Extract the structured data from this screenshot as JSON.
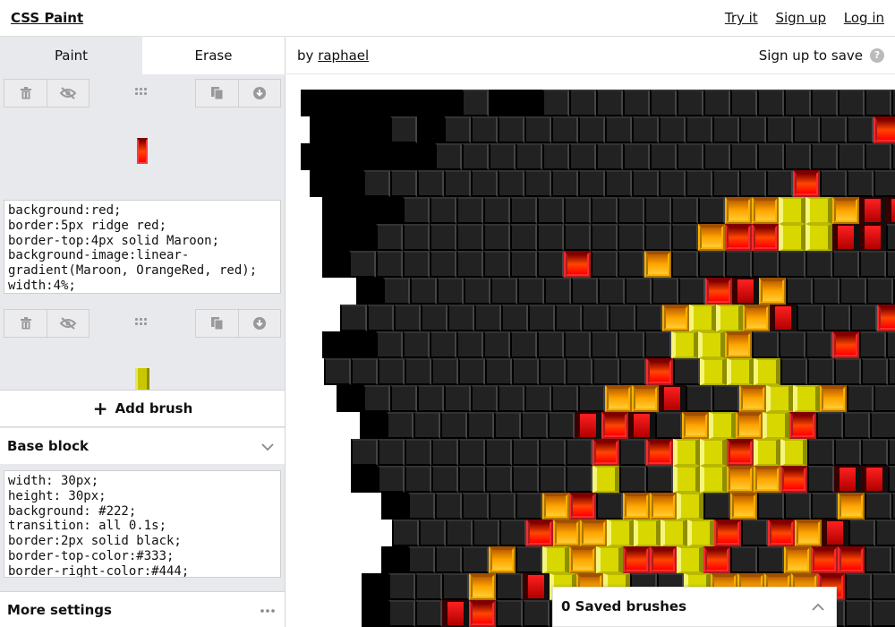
{
  "header": {
    "brand": "CSS Paint",
    "links": [
      "Try it",
      "Sign up",
      "Log in"
    ]
  },
  "tabs": {
    "paint": "Paint",
    "erase": "Erase"
  },
  "brushes": [
    {
      "css": "background:red;\nborder:5px ridge red;\nborder-top:4px solid Maroon;\nbackground-image:linear-gradient(Maroon, OrangeRed, red);\nwidth:4%;"
    },
    {
      "css": ""
    }
  ],
  "tools": {
    "left": [
      "trash-icon",
      "eye-off-icon"
    ],
    "middle": "drag-handle-icon",
    "right": [
      "copy-icon",
      "download-icon"
    ]
  },
  "add_brush": {
    "plus": "+",
    "label": "Add brush"
  },
  "base_block": {
    "title": "Base block",
    "css": "width: 30px;\nheight: 30px;\nbackground: #222;\ntransition: all 0.1s;\nborder:2px solid black;\nborder-top-color:#333;\nborder-right-color:#444;"
  },
  "more_settings": {
    "title": "More settings",
    "icon": "ellipsis-icon"
  },
  "subbar": {
    "by": "by",
    "author": "raphael",
    "save": "Sign up to save",
    "help": "?"
  },
  "saved_brushes": {
    "label": "0 Saved brushes",
    "icon": "chevron-up-icon"
  },
  "canvas": {
    "rows": [
      "kkkkkk.kk.ggggggggggggggggggggggg",
      "kkk.kggggggggggggggggrgggggggg",
      "kkkkkgggggggggggggggggggggggggm",
      "kkggggggggggggggggrggggggggggm",
      "kkkggggggggggggooyyommggggggg",
      "kkggggggggggggorryymmggggggg",
      "kggggggggrggoggggggggggggoo",
      "kggggggggggggrmogggggrorrr",
      "ggggggggggggoyyomgggrrggg",
      "kkgggggggggggyyogggrgggg",
      "ggggggggggggrgyyygggggg",
      "kgggggggggoomggoyyoggggg",
      "kgggggggmrmgoyoyrggggg",
      "gggggggggrgryyryygggg",
      "kggggggggyggyyoorgmm",
      "kgggggorgooygogggo",
      "gggggrooyyyyrgrom",
      "kgggogyoyrryrggorr",
      "kgggogmyoyggyoooor",
      "kggmrgggggrggoorr"
    ],
    "offsets": [
      16,
      26,
      16,
      26,
      40,
      40,
      40,
      78,
      60,
      40,
      42,
      56,
      82,
      72,
      72,
      106,
      118,
      106,
      84,
      84
    ]
  }
}
